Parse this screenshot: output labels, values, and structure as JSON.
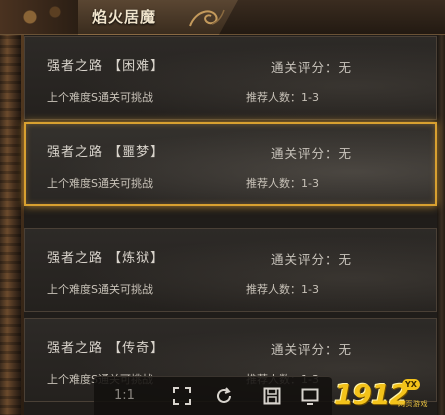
{
  "header": {
    "title": "焰火居魔"
  },
  "cards": [
    {
      "name": "强者之路 【困难】",
      "score": "通关评分：无",
      "unlock": "上个难度S通关可挑战",
      "players": "推荐人数：1-3",
      "selected": false
    },
    {
      "name": "强者之路 【噩梦】",
      "score": "通关评分：无",
      "unlock": "上个难度S通关可挑战",
      "players": "推荐人数：1-3",
      "selected": true
    },
    {
      "name": "强者之路 【炼狱】",
      "score": "通关评分：无",
      "unlock": "上个难度S通关可挑战",
      "players": "推荐人数：1-3",
      "selected": false
    },
    {
      "name": "强者之路 【传奇】",
      "score": "通关评分：无",
      "unlock": "上个难度S通关可挑战",
      "players": "推荐人数：1-3",
      "selected": false
    }
  ],
  "toolbar": {
    "ratio_label": "1:1",
    "buttons": [
      {
        "icon": "fit-screen-icon"
      },
      {
        "icon": "refresh-icon"
      },
      {
        "icon": "save-icon"
      },
      {
        "icon": "fullscreen-icon"
      }
    ]
  },
  "logo": {
    "number": "1912",
    "badge": "YX",
    "subtitle": "网页游戏"
  },
  "colors": {
    "selected_border": "#d8a030",
    "card_text": "#d9d4cc",
    "logo_yellow": "#f3c21a"
  }
}
